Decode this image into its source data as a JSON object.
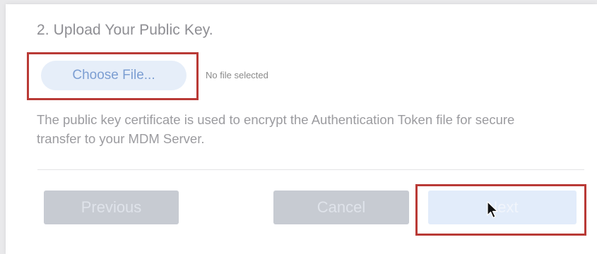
{
  "step": {
    "title": "2. Upload Your Public Key."
  },
  "file_input": {
    "button_label": "Choose File...",
    "status": "No file selected"
  },
  "description": "The public key certificate is used to encrypt the Authentication Token file for secure transfer to your MDM Server.",
  "footer": {
    "previous_label": "Previous",
    "cancel_label": "Cancel",
    "next_label": "Next"
  },
  "colors": {
    "highlight": "#b93a36",
    "choose_button_bg": "#e6eef9",
    "choose_button_text": "#7c9ed2",
    "disabled_button_bg": "#c7cbd2",
    "next_button_bg": "#e2ecfa"
  },
  "icons": {
    "pointer": "mouse-pointer-icon"
  }
}
